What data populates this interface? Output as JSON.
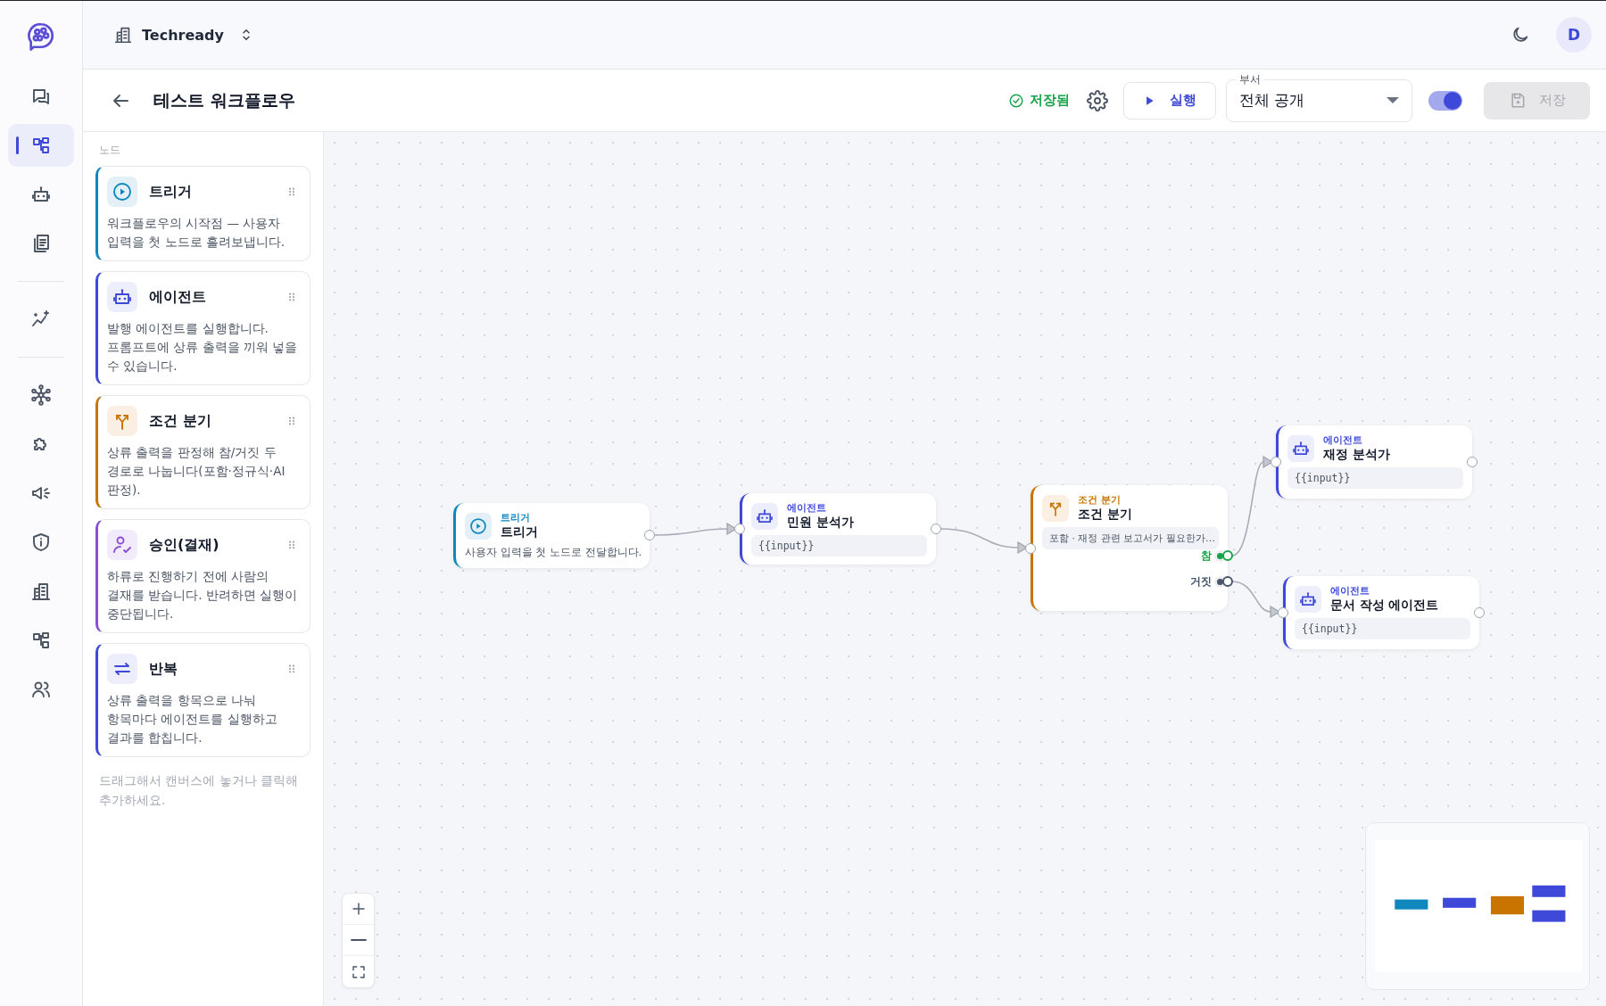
{
  "top_bar": {
    "workspace": "Techready",
    "avatar": "D"
  },
  "rail": {
    "groups": [
      [
        {
          "kind": "chat",
          "selected": false
        },
        {
          "kind": "workflow",
          "selected": true
        },
        {
          "kind": "bot",
          "selected": false
        },
        {
          "kind": "docs",
          "selected": false
        }
      ],
      [
        {
          "kind": "analytics",
          "selected": false
        }
      ],
      [
        {
          "kind": "network",
          "selected": false
        },
        {
          "kind": "puzzle",
          "selected": false
        },
        {
          "kind": "megaphone",
          "selected": false
        },
        {
          "kind": "shield",
          "selected": false
        },
        {
          "kind": "building",
          "selected": false
        },
        {
          "kind": "workflow",
          "selected": false
        },
        {
          "kind": "users",
          "selected": false
        }
      ]
    ]
  },
  "header": {
    "title": "테스트 워크플로우",
    "status": "저장됨",
    "run_button": "실행",
    "department": {
      "label": "부서",
      "value": "전체 공개"
    },
    "toggle": {
      "on": true
    },
    "save_button": {
      "label": "저장",
      "disabled": true
    }
  },
  "palette": {
    "heading": "노드",
    "items": [
      {
        "kind": "trigger",
        "title": "트리거",
        "description": "워크플로우의 시작점 — 사용자 입력을 첫 노드로 흘려보냅니다."
      },
      {
        "kind": "agent",
        "title": "에이전트",
        "description": "발행 에이전트를 실행합니다. 프롬프트에 상류 출력을 끼워 넣을 수 있습니다."
      },
      {
        "kind": "condition",
        "title": "조건 분기",
        "description": "상류 출력을 판정해 참/거짓 두 경로로 나눕니다(포함·정규식·AI 판정)."
      },
      {
        "kind": "approval",
        "title": "승인(결재)",
        "description": "하류로 진행하기 전에 사람의 결재를 받습니다. 반려하면 실행이 중단됩니다."
      },
      {
        "kind": "loop",
        "title": "반복",
        "description": "상류 출력을 항목으로 나눠 항목마다 에이전트를 실행하고 결과를 합칩니다."
      }
    ],
    "hint": "드래그해서 캔버스에 놓거나 클릭해 추가하세요."
  },
  "canvas": {
    "nodes": [
      {
        "kind": "trigger",
        "type_label": "트리거",
        "title": "트리거",
        "body": "사용자 입력을 첫 노드로 전달합니다."
      },
      {
        "kind": "agent",
        "type_label": "에이전트",
        "title": "민원 분석가",
        "body": "{{input}}"
      },
      {
        "kind": "condition",
        "type_label": "조건 분기",
        "title": "조건 분기",
        "body": "포함 · 재정 관련 보고서가 필요한가…",
        "outputs": [
          {
            "kind": "true",
            "label": "참"
          },
          {
            "kind": "false",
            "label": "거짓"
          }
        ]
      },
      {
        "kind": "agent",
        "type_label": "에이전트",
        "title": "재정 분석가",
        "body": "{{input}}"
      },
      {
        "kind": "agent",
        "type_label": "에이전트",
        "title": "문서 작성 에이전트",
        "body": "{{input}}"
      }
    ]
  }
}
